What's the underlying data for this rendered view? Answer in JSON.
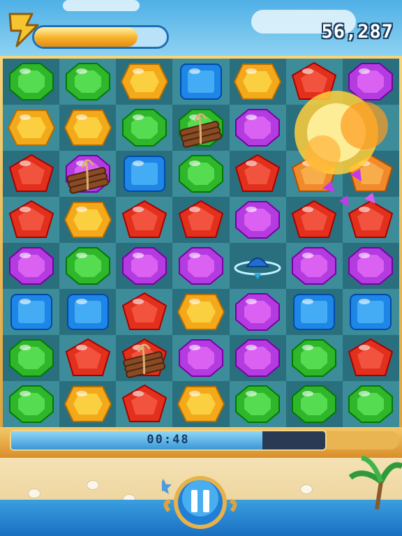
{
  "hud": {
    "score": "56,287",
    "energy_level": 0.78,
    "energy_icon": "lightning-bolt-icon"
  },
  "board": {
    "columns": 7,
    "rows": 8,
    "cells": [
      [
        "green",
        "green",
        "yellow",
        "blue",
        "yellow",
        "red",
        "purple"
      ],
      [
        "yellow",
        "yellow",
        "green",
        "green",
        "purple",
        "explosion",
        "explosion"
      ],
      [
        "red",
        "purple",
        "blue",
        "green",
        "red",
        "orange",
        "orange"
      ],
      [
        "red",
        "yellow",
        "red",
        "red",
        "purple",
        "red",
        "red"
      ],
      [
        "purple",
        "green",
        "purple",
        "purple",
        "blue-orb",
        "purple",
        "purple"
      ],
      [
        "blue",
        "blue",
        "red",
        "yellow",
        "purple",
        "blue",
        "blue"
      ],
      [
        "green",
        "red",
        "red",
        "purple",
        "purple",
        "green",
        "red"
      ],
      [
        "green",
        "yellow",
        "red",
        "yellow",
        "green",
        "green",
        "green"
      ]
    ],
    "bombs": [
      [
        1,
        3
      ],
      [
        2,
        1
      ],
      [
        6,
        2
      ]
    ],
    "gem_colors": {
      "green": "#2fb62b",
      "yellow": "#f4a91a",
      "blue": "#1e86e6",
      "red": "#e2301c",
      "purple": "#b43be0",
      "orange": "#f08a2a"
    }
  },
  "timer": {
    "text": "00:48",
    "remaining_fraction": 0.8
  },
  "controls": {
    "pause_icon": "pause-icon"
  }
}
